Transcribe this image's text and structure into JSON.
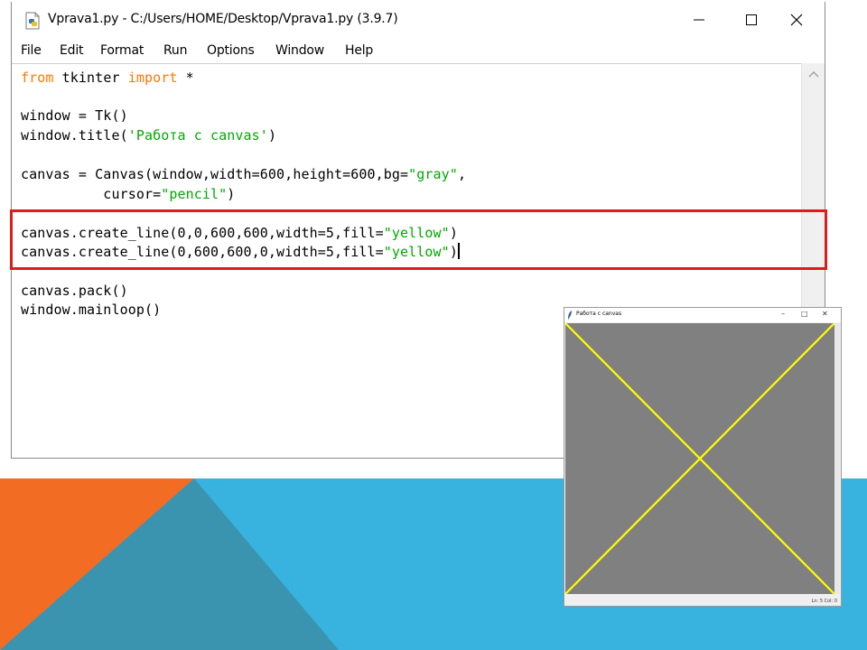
{
  "colors": {
    "slide_orange": "#f26c23",
    "slide_blue": "#38b2df",
    "slide_teal": "#3a94af",
    "highlight_red": "#e01b1b",
    "canvas_gray": "#808080",
    "line_yellow": "#ffff00",
    "keyword_orange": "#ff7700",
    "string_green": "#00aa00"
  },
  "idle": {
    "title": "Vprava1.py - C:/Users/HOME/Desktop/Vprava1.py (3.9.7)",
    "icon": "python-file-icon",
    "controls": [
      "minimize-icon",
      "maximize-icon",
      "close-icon"
    ],
    "menu": [
      "File",
      "Edit",
      "Format",
      "Run",
      "Options",
      "Window",
      "Help"
    ],
    "code": {
      "l1_kw1": "from",
      "l1_mid": " tkinter ",
      "l1_kw2": "import",
      "l1_end": " *",
      "l3": "window = Tk()",
      "l4_pre": "window.title(",
      "l4_str": "'Работа с canvas'",
      "l4_post": ")",
      "l6_pre": "canvas = Canvas(window,width=600,height=600,bg=",
      "l6_str": "\"gray\"",
      "l6_post": ",",
      "l7_pre": "          cursor=",
      "l7_str": "\"pencil\"",
      "l7_post": ")",
      "l9_pre": "canvas.create_line(0,0,600,600,width=5,fill=",
      "l9_str": "\"yellow\"",
      "l9_post": ")",
      "l10_pre": "canvas.create_line(0,600,600,0,width=5,fill=",
      "l10_str": "\"yellow\"",
      "l10_post": ")",
      "l12": "canvas.pack()",
      "l13": "window.mainloop()"
    }
  },
  "tk": {
    "title": "Работа с canvas",
    "controls": [
      "minimize-icon",
      "maximize-icon",
      "close-icon"
    ],
    "status": "Ln: 5   Col: 0"
  }
}
